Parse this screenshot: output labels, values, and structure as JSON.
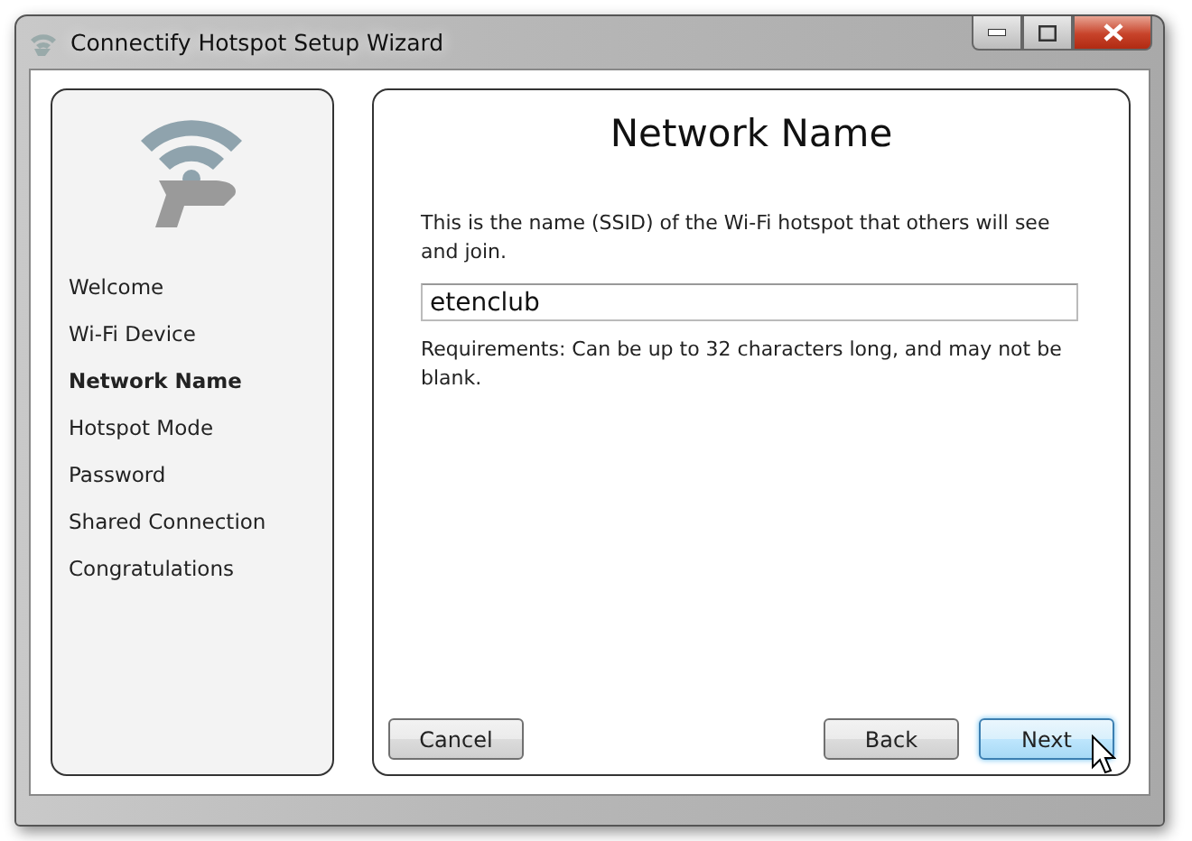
{
  "window": {
    "title": "Connectify Hotspot Setup Wizard"
  },
  "steps": [
    {
      "label": "Welcome",
      "selected": false
    },
    {
      "label": "Wi-Fi Device",
      "selected": false
    },
    {
      "label": "Network Name",
      "selected": true
    },
    {
      "label": "Hotspot Mode",
      "selected": false
    },
    {
      "label": "Password",
      "selected": false
    },
    {
      "label": "Shared Connection",
      "selected": false
    },
    {
      "label": "Congratulations",
      "selected": false
    }
  ],
  "page": {
    "heading": "Network Name",
    "description": "This is the name (SSID) of the Wi-Fi hotspot that others will see and join.",
    "ssid_field": {
      "value": "etenclub"
    },
    "requirements": "Requirements: Can be up to 32 characters long, and may not be blank."
  },
  "buttons": {
    "left": [
      {
        "label": "Cancel",
        "hovered": false
      }
    ],
    "right": [
      {
        "label": "Back",
        "hovered": false
      },
      {
        "label": "Next",
        "hovered": true
      }
    ]
  }
}
